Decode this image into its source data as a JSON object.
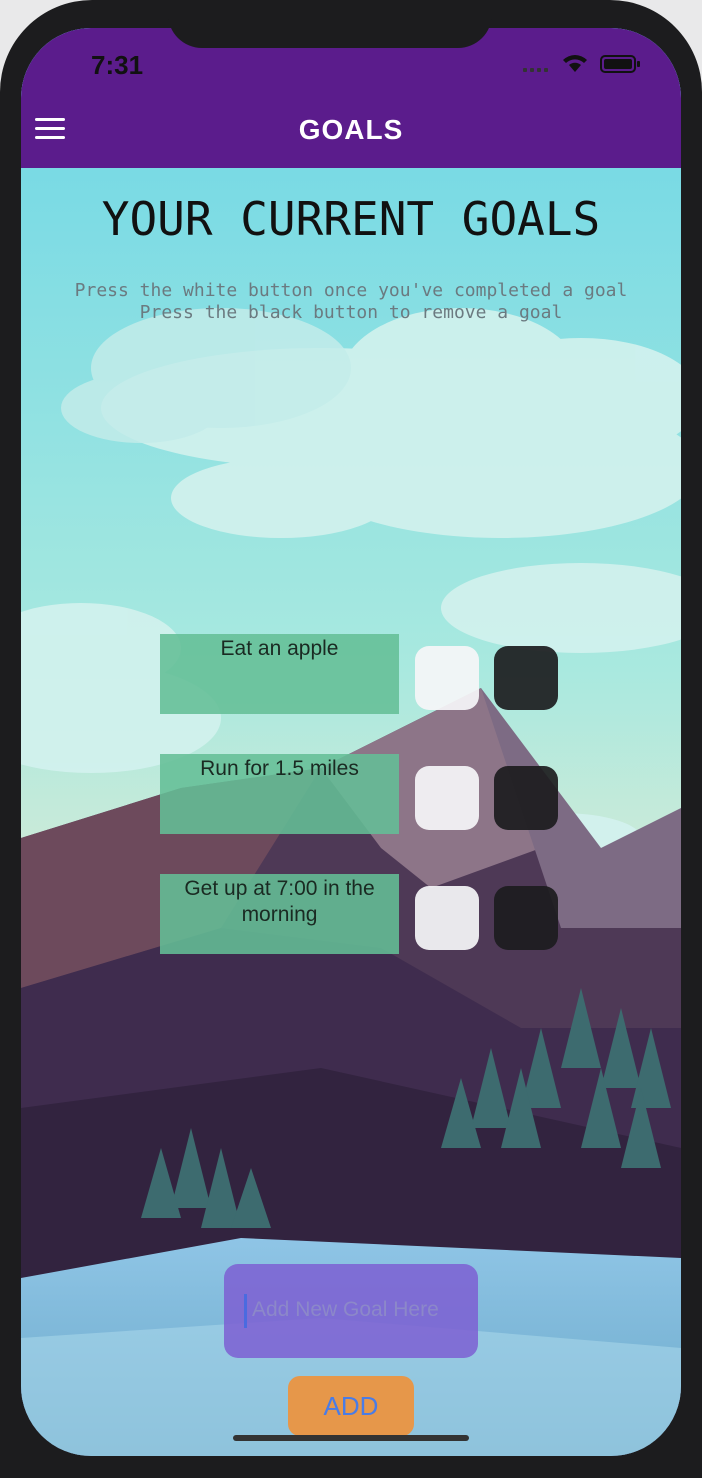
{
  "status_bar": {
    "time": "7:31"
  },
  "nav": {
    "title": "GOALS"
  },
  "main": {
    "title": "YOUR CURRENT GOALS",
    "instruction_1": "Press the white button once you've completed a goal",
    "instruction_2": "Press the black button to remove a goal",
    "goals": [
      {
        "text": "Eat an apple"
      },
      {
        "text": "Run for 1.5 miles"
      },
      {
        "text": "Get up at 7:00 in the morning"
      }
    ]
  },
  "new_goal": {
    "placeholder": "Add New Goal Here",
    "value": ""
  },
  "add_button": {
    "label": "ADD"
  },
  "colors": {
    "nav_bg": "#5b1c8c",
    "goal_box": "#64be96",
    "complete_button": "#f5f5f7",
    "remove_button": "#1c1c1e",
    "input_bg": "#7d5fd2",
    "add_button_bg": "#e6974a",
    "add_button_text": "#4a7ce6"
  }
}
